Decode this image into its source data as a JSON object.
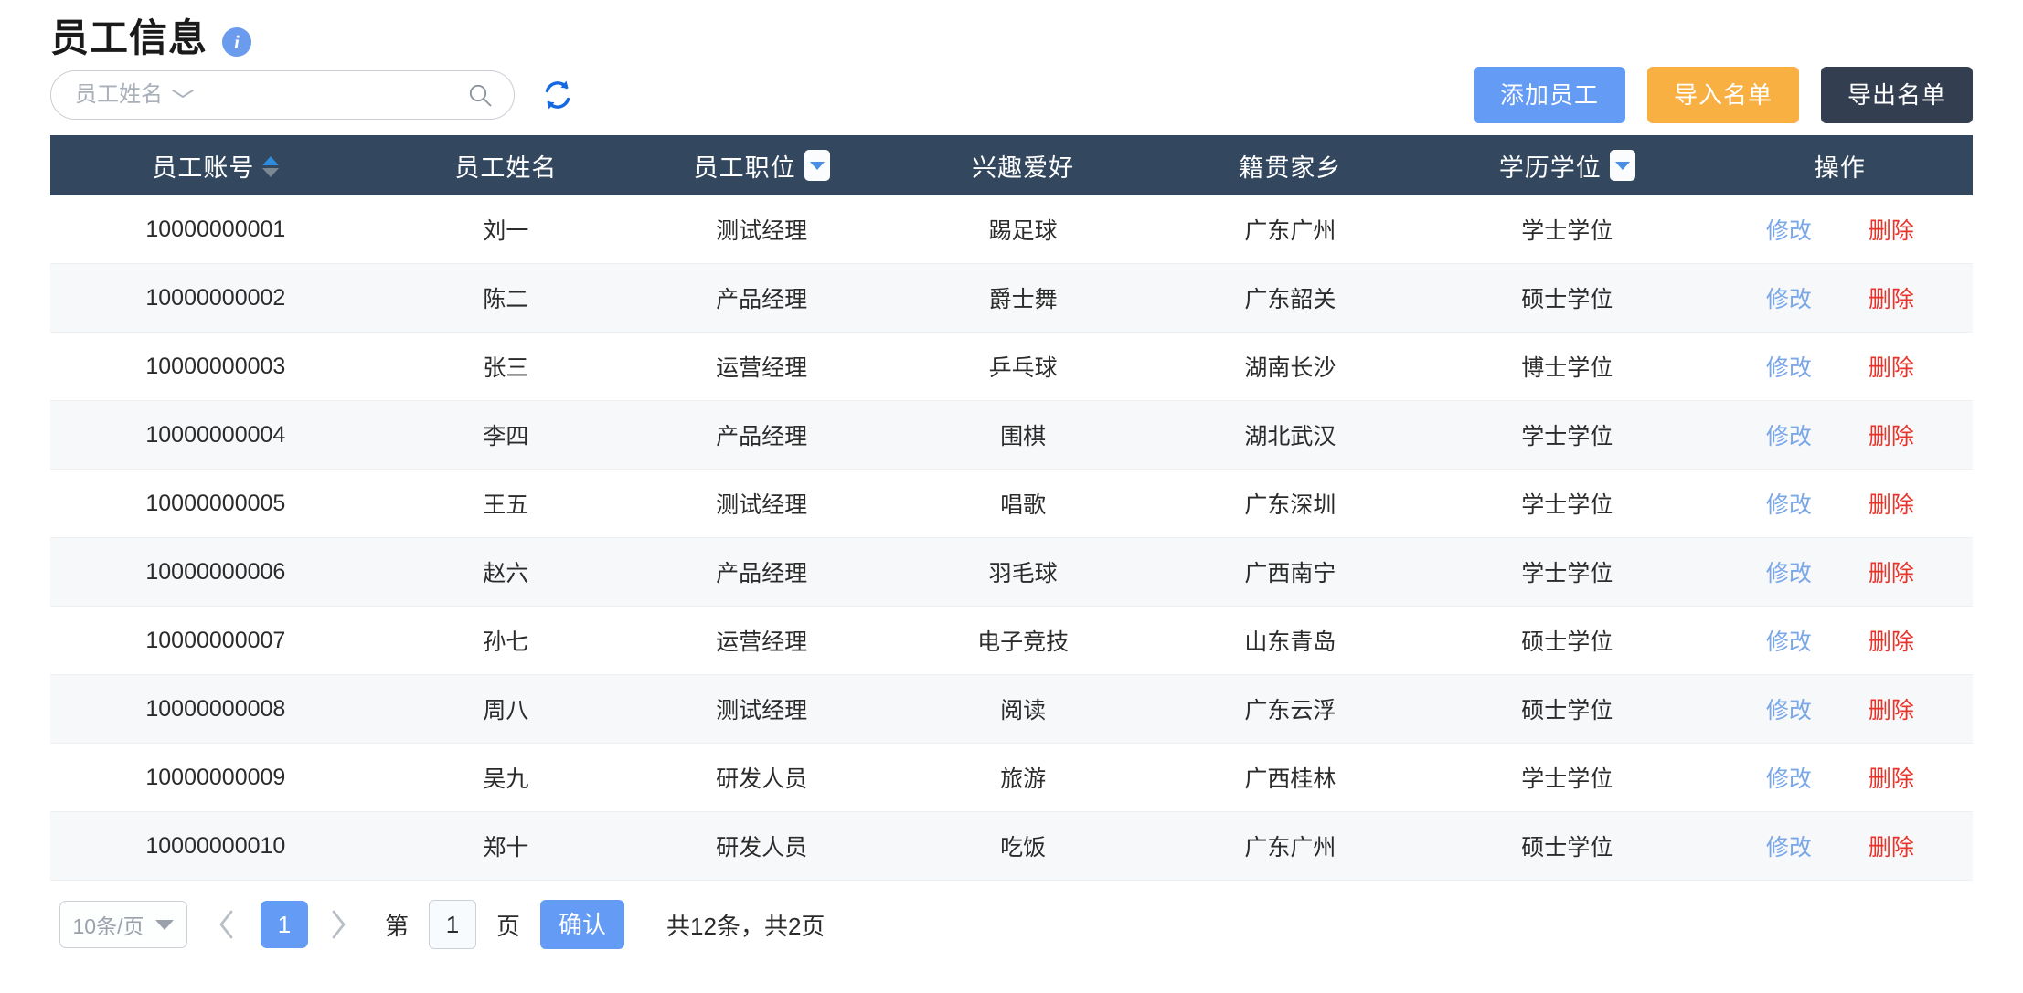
{
  "header": {
    "title": "员工信息",
    "info_icon": "info-circle-icon"
  },
  "search": {
    "placeholder": "员工姓名",
    "value": "",
    "caret": "⌄",
    "search_icon": "search-icon",
    "refresh_icon": "refresh-icon"
  },
  "toolbar": {
    "add_label": "添加员工",
    "import_label": "导入名单",
    "export_label": "导出名单",
    "colors": {
      "add": "#639bf5",
      "import": "#f8b043",
      "export": "#333f50"
    }
  },
  "table": {
    "header_bg": "#33475e",
    "columns": [
      {
        "label": "员工账号",
        "sortable": true,
        "filterable": false
      },
      {
        "label": "员工姓名",
        "sortable": false,
        "filterable": false
      },
      {
        "label": "员工职位",
        "sortable": false,
        "filterable": true
      },
      {
        "label": "兴趣爱好",
        "sortable": false,
        "filterable": false
      },
      {
        "label": "籍贯家乡",
        "sortable": false,
        "filterable": false
      },
      {
        "label": "学历学位",
        "sortable": false,
        "filterable": true
      },
      {
        "label": "操作",
        "sortable": false,
        "filterable": false
      }
    ],
    "row_actions": {
      "edit": "修改",
      "delete": "删除",
      "edit_color": "#7aa7e8",
      "delete_color": "#e8332a"
    },
    "rows": [
      {
        "account": "10000000001",
        "name": "刘一",
        "position": "测试经理",
        "hobby": "踢足球",
        "hometown": "广东广州",
        "degree": "学士学位"
      },
      {
        "account": "10000000002",
        "name": "陈二",
        "position": "产品经理",
        "hobby": "爵士舞",
        "hometown": "广东韶关",
        "degree": "硕士学位"
      },
      {
        "account": "10000000003",
        "name": "张三",
        "position": "运营经理",
        "hobby": "乒乓球",
        "hometown": "湖南长沙",
        "degree": "博士学位"
      },
      {
        "account": "10000000004",
        "name": "李四",
        "position": "产品经理",
        "hobby": "围棋",
        "hometown": "湖北武汉",
        "degree": "学士学位"
      },
      {
        "account": "10000000005",
        "name": "王五",
        "position": "测试经理",
        "hobby": "唱歌",
        "hometown": "广东深圳",
        "degree": "学士学位"
      },
      {
        "account": "10000000006",
        "name": "赵六",
        "position": "产品经理",
        "hobby": "羽毛球",
        "hometown": "广西南宁",
        "degree": "学士学位"
      },
      {
        "account": "10000000007",
        "name": "孙七",
        "position": "运营经理",
        "hobby": "电子竞技",
        "hometown": "山东青岛",
        "degree": "硕士学位"
      },
      {
        "account": "10000000008",
        "name": "周八",
        "position": "测试经理",
        "hobby": "阅读",
        "hometown": "广东云浮",
        "degree": "硕士学位"
      },
      {
        "account": "10000000009",
        "name": "吴九",
        "position": "研发人员",
        "hobby": "旅游",
        "hometown": "广西桂林",
        "degree": "学士学位"
      },
      {
        "account": "10000000010",
        "name": "郑十",
        "position": "研发人员",
        "hobby": "吃饭",
        "hometown": "广东广州",
        "degree": "硕士学位"
      }
    ]
  },
  "pagination": {
    "page_size_label": "10条/页",
    "prev_icon": "chevron-left-icon",
    "next_icon": "chevron-right-icon",
    "current_page": "1",
    "jump_prefix": "第",
    "jump_value": "1",
    "jump_suffix": "页",
    "confirm_label": "确认",
    "total_text": "共12条，共2页"
  }
}
